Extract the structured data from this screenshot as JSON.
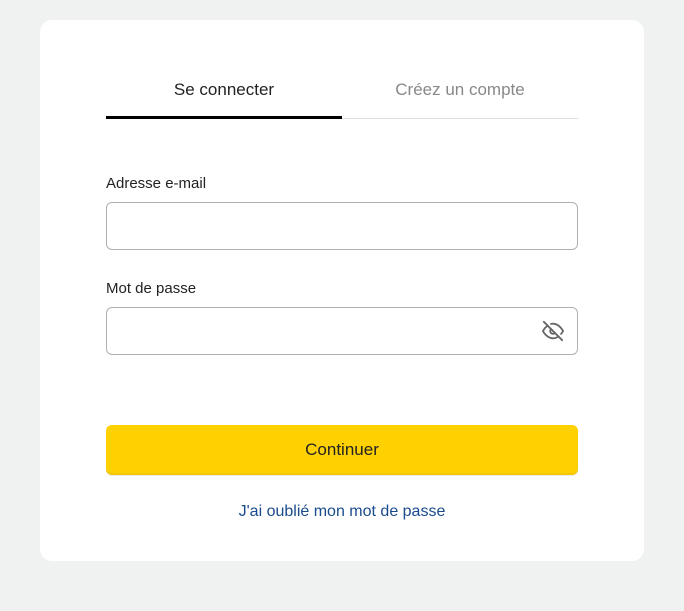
{
  "tabs": {
    "login": "Se connecter",
    "register": "Créez un compte"
  },
  "form": {
    "email_label": "Adresse e-mail",
    "email_value": "",
    "password_label": "Mot de passe",
    "password_value": ""
  },
  "actions": {
    "continue_label": "Continuer",
    "forgot_label": "J'ai oublié mon mot de passe"
  }
}
